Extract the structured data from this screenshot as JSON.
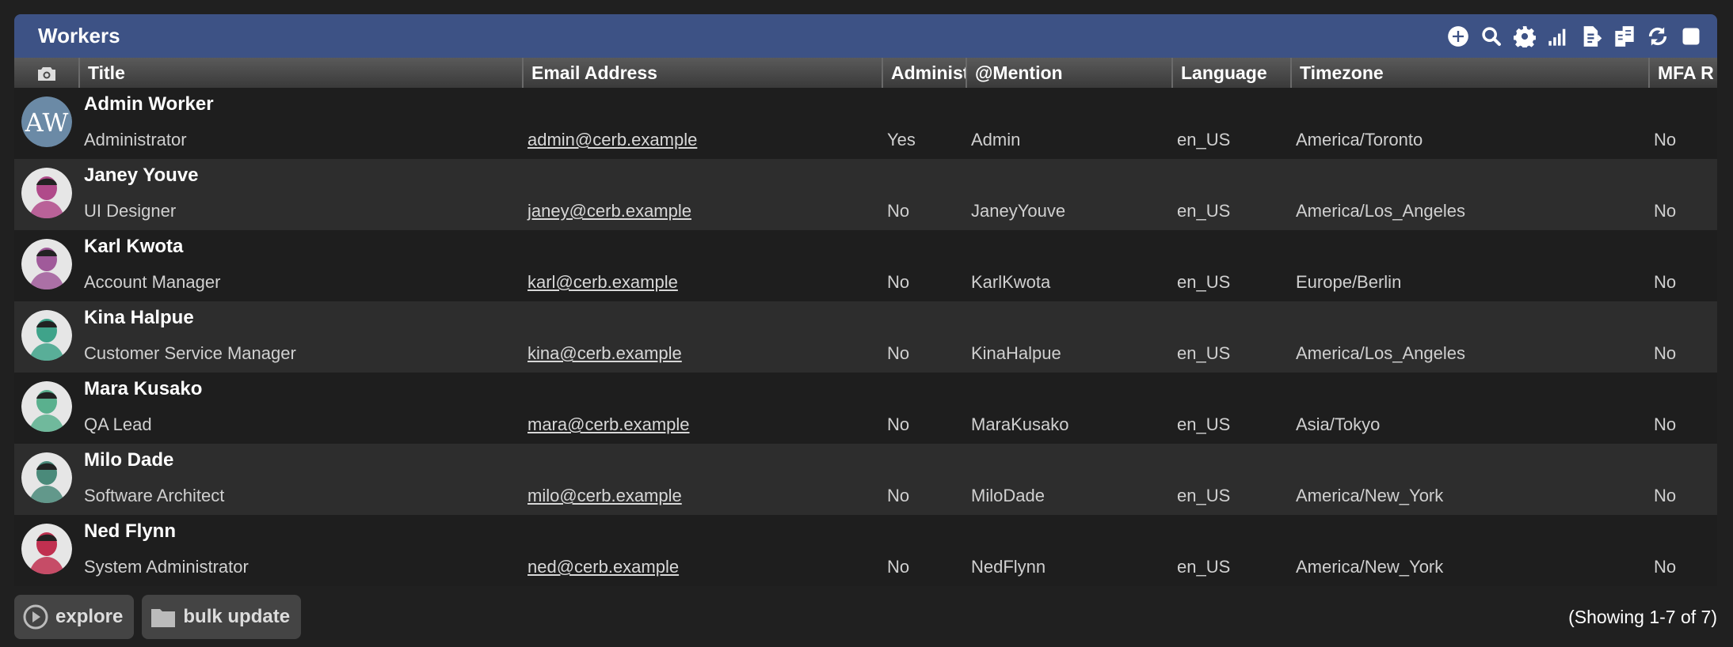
{
  "panel": {
    "title": "Workers",
    "toolbar": [
      "add-icon",
      "search-icon",
      "gear-icon",
      "chart-icon",
      "export-icon",
      "copy-icon",
      "refresh-icon",
      "checkbox-icon"
    ]
  },
  "columns": [
    "Title",
    "Email Address",
    "Administ",
    "@Mention",
    "Language",
    "Timezone",
    "MFA R"
  ],
  "workers": [
    {
      "name": "Admin Worker",
      "initials": "AW",
      "title": "Administrator",
      "email": "admin@cerb.example",
      "admin": "Yes",
      "mention": "Admin",
      "language": "en_US",
      "timezone": "America/Toronto",
      "mfa": "No",
      "avatar_color": "#6b8aa6"
    },
    {
      "name": "Janey Youve",
      "title": "UI Designer",
      "email": "janey@cerb.example",
      "admin": "No",
      "mention": "JaneyYouve",
      "language": "en_US",
      "timezone": "America/Los_Angeles",
      "mfa": "No",
      "avatar_color": "#b04a8a"
    },
    {
      "name": "Karl Kwota",
      "title": "Account Manager",
      "email": "karl@cerb.example",
      "admin": "No",
      "mention": "KarlKwota",
      "language": "en_US",
      "timezone": "Europe/Berlin",
      "mfa": "No",
      "avatar_color": "#a05a9a"
    },
    {
      "name": "Kina Halpue",
      "title": "Customer Service Manager",
      "email": "kina@cerb.example",
      "admin": "No",
      "mention": "KinaHalpue",
      "language": "en_US",
      "timezone": "America/Los_Angeles",
      "mfa": "No",
      "avatar_color": "#3fa38a"
    },
    {
      "name": "Mara Kusako",
      "title": "QA Lead",
      "email": "mara@cerb.example",
      "admin": "No",
      "mention": "MaraKusako",
      "language": "en_US",
      "timezone": "Asia/Tokyo",
      "mfa": "No",
      "avatar_color": "#5ab08e"
    },
    {
      "name": "Milo Dade",
      "title": "Software Architect",
      "email": "milo@cerb.example",
      "admin": "No",
      "mention": "MiloDade",
      "language": "en_US",
      "timezone": "America/New_York",
      "mfa": "No",
      "avatar_color": "#4a8a7a"
    },
    {
      "name": "Ned Flynn",
      "title": "System Administrator",
      "email": "ned@cerb.example",
      "admin": "No",
      "mention": "NedFlynn",
      "language": "en_US",
      "timezone": "America/New_York",
      "mfa": "No",
      "avatar_color": "#c03050"
    }
  ],
  "footer": {
    "explore_label": "explore",
    "bulk_update_label": "bulk update",
    "showing": "(Showing 1-7 of 7)"
  }
}
